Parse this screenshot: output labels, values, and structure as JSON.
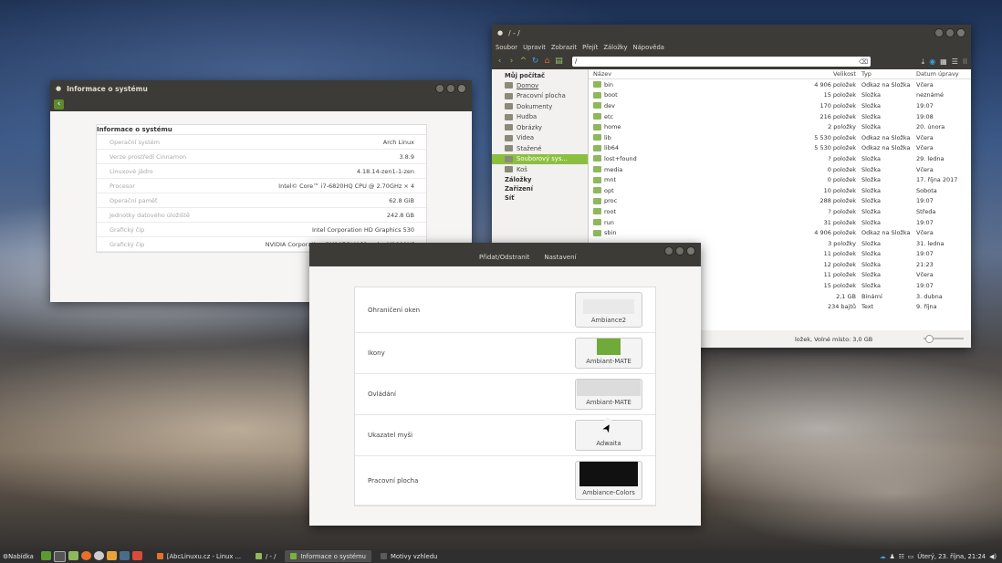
{
  "sysinfo": {
    "title": "Informace o systému",
    "table_title": "Informace o systému",
    "rows": [
      {
        "key": "Operační systém",
        "value": "Arch Linux"
      },
      {
        "key": "Verze prostředí Cinnamon",
        "value": "3.8.9"
      },
      {
        "key": "Linuxové jádro",
        "value": "4.18.14-zen1-1-zen"
      },
      {
        "key": "Procesor",
        "value": "Intel© Core™ i7-6820HQ CPU @ 2.70GHz × 4"
      },
      {
        "key": "Operační paměť",
        "value": "62.8 GiB"
      },
      {
        "key": "Jednotky datového úložiště",
        "value": "242.8 GB"
      },
      {
        "key": "Grafický čip",
        "value": "Intel Corporation HD Graphics 530"
      },
      {
        "key": "Grafický čip",
        "value": "NVIDIA Corporation GM107GLM [Quadro M1000M]"
      }
    ]
  },
  "nemo": {
    "title": "/ - /",
    "menu": [
      "Soubor",
      "Upravit",
      "Zobrazit",
      "Přejít",
      "Záložky",
      "Nápověda"
    ],
    "path": "/",
    "sidebar": [
      {
        "label": "Můj počítač",
        "type": "head"
      },
      {
        "label": "Domov",
        "type": "link"
      },
      {
        "label": "Pracovní plocha",
        "type": "item"
      },
      {
        "label": "Dokumenty",
        "type": "item"
      },
      {
        "label": "Hudba",
        "type": "item"
      },
      {
        "label": "Obrázky",
        "type": "item"
      },
      {
        "label": "Videa",
        "type": "item"
      },
      {
        "label": "Stažené",
        "type": "item"
      },
      {
        "label": "Souborový sys...",
        "type": "sel"
      },
      {
        "label": "Koš",
        "type": "item"
      },
      {
        "label": "Záložky",
        "type": "head"
      },
      {
        "label": "Zařízení",
        "type": "head"
      },
      {
        "label": "Síť",
        "type": "head"
      }
    ],
    "columns": {
      "name": "Název",
      "size": "Velikost",
      "type": "Typ",
      "date": "Datum úpravy"
    },
    "files": [
      {
        "name": "bin",
        "size": "4 906 položek",
        "type": "Odkaz na Složka",
        "date": "Včera"
      },
      {
        "name": "boot",
        "size": "15 položek",
        "type": "Složka",
        "date": "neznámé"
      },
      {
        "name": "dev",
        "size": "170 položek",
        "type": "Složka",
        "date": "19:07"
      },
      {
        "name": "etc",
        "size": "216 položek",
        "type": "Složka",
        "date": "19:08"
      },
      {
        "name": "home",
        "size": "2 položky",
        "type": "Složka",
        "date": "20. února"
      },
      {
        "name": "lib",
        "size": "5 530 položek",
        "type": "Odkaz na Složka",
        "date": "Včera"
      },
      {
        "name": "lib64",
        "size": "5 530 položek",
        "type": "Odkaz na Složka",
        "date": "Včera"
      },
      {
        "name": "lost+found",
        "size": "? položek",
        "type": "Složka",
        "date": "29. ledna"
      },
      {
        "name": "media",
        "size": "0 položek",
        "type": "Složka",
        "date": "Včera"
      },
      {
        "name": "mnt",
        "size": "0 položek",
        "type": "Složka",
        "date": "17. října 2017"
      },
      {
        "name": "opt",
        "size": "10 položek",
        "type": "Složka",
        "date": "Sobota"
      },
      {
        "name": "proc",
        "size": "288 položek",
        "type": "Složka",
        "date": "19:07"
      },
      {
        "name": "root",
        "size": "? položek",
        "type": "Složka",
        "date": "Středa"
      },
      {
        "name": "run",
        "size": "31 položek",
        "type": "Složka",
        "date": "19:07"
      },
      {
        "name": "sbin",
        "size": "4 906 položek",
        "type": "Odkaz na Složka",
        "date": "Včera"
      },
      {
        "name": "",
        "size": "3 položky",
        "type": "Složka",
        "date": "31. ledna"
      },
      {
        "name": "",
        "size": "11 položek",
        "type": "Složka",
        "date": "19:07"
      },
      {
        "name": "",
        "size": "12 položek",
        "type": "Složka",
        "date": "21:23"
      },
      {
        "name": "",
        "size": "11 položek",
        "type": "Složka",
        "date": "Včera"
      },
      {
        "name": "",
        "size": "15 položek",
        "type": "Složka",
        "date": "19:07"
      },
      {
        "name": "",
        "size": "2,1 GB",
        "type": "Binární",
        "date": "3. dubna"
      },
      {
        "name": "",
        "size": "234 bajtů",
        "type": "Text",
        "date": "9. října"
      }
    ],
    "status": "ložek, Volné místo: 3,0 GB"
  },
  "themes": {
    "tabs": [
      "Přidat/Odstranit",
      "Nastavení"
    ],
    "rows": [
      {
        "label": "Ohraničení oken",
        "value": "Ambiance2"
      },
      {
        "label": "Ikony",
        "value": "Ambiant-MATE"
      },
      {
        "label": "Ovládání",
        "value": "Ambiant-MATE"
      },
      {
        "label": "Ukazatel myši",
        "value": "Adwaita"
      },
      {
        "label": "Pracovní plocha",
        "value": "Ambiance-Colors"
      }
    ]
  },
  "taskbar": {
    "menu": "Nabídka",
    "tasks": [
      "[AbcLinuxu.cz - Linux ...",
      "/ - /",
      "Informace o systému",
      "Motivy vzhledu"
    ],
    "clock": "Úterý, 23. října, 21:24"
  }
}
